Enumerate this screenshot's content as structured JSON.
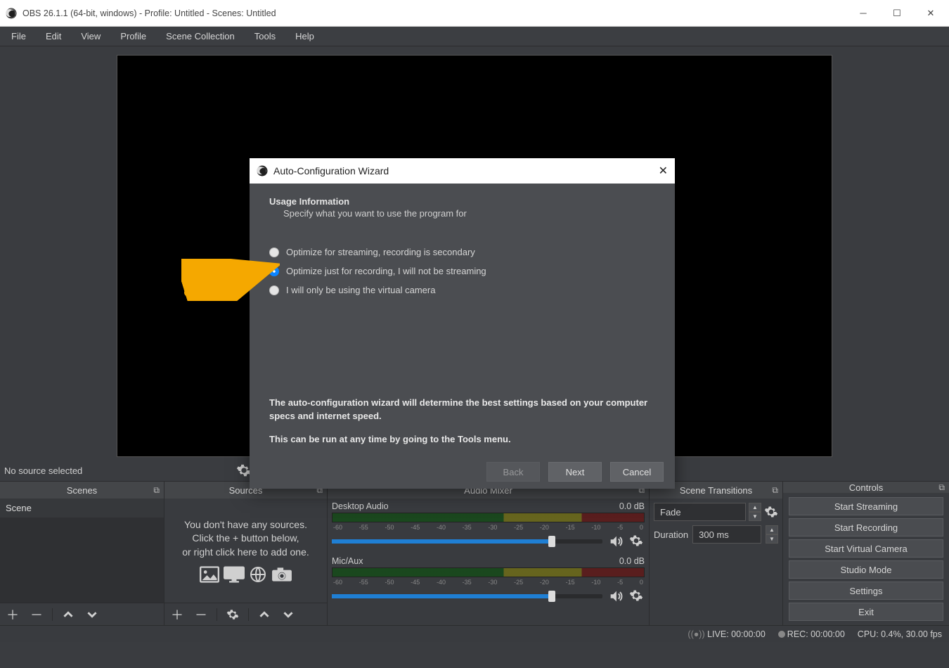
{
  "window": {
    "title": "OBS 26.1.1 (64-bit, windows) - Profile: Untitled - Scenes: Untitled"
  },
  "menus": [
    "File",
    "Edit",
    "View",
    "Profile",
    "Scene Collection",
    "Tools",
    "Help"
  ],
  "preview": {
    "no_source": "No source selected"
  },
  "docks": {
    "scenes": {
      "title": "Scenes",
      "item": "Scene"
    },
    "sources": {
      "title": "Sources",
      "empty1": "You don't have any sources.",
      "empty2": "Click the + button below,",
      "empty3": "or right click here to add one."
    },
    "mixer": {
      "title": "Audio Mixer",
      "channels": [
        {
          "name": "Desktop Audio",
          "level": "0.0 dB",
          "ticks": [
            "-60",
            "-55",
            "-50",
            "-45",
            "-40",
            "-35",
            "-30",
            "-25",
            "-20",
            "-15",
            "-10",
            "-5",
            "0"
          ]
        },
        {
          "name": "Mic/Aux",
          "level": "0.0 dB",
          "ticks": [
            "-60",
            "-55",
            "-50",
            "-45",
            "-40",
            "-35",
            "-30",
            "-25",
            "-20",
            "-15",
            "-10",
            "-5",
            "0"
          ]
        }
      ]
    },
    "transitions": {
      "title": "Scene Transitions",
      "fade": "Fade",
      "durationLabel": "Duration",
      "durationValue": "300 ms"
    },
    "controls": {
      "title": "Controls",
      "buttons": [
        "Start Streaming",
        "Start Recording",
        "Start Virtual Camera",
        "Studio Mode",
        "Settings",
        "Exit"
      ]
    }
  },
  "status": {
    "live": "LIVE: 00:00:00",
    "rec": "REC: 00:00:00",
    "cpu": "CPU: 0.4%, 30.00 fps"
  },
  "modal": {
    "title": "Auto-Configuration Wizard",
    "heading": "Usage Information",
    "sub": "Specify what you want to use the program for",
    "options": [
      "Optimize for streaming, recording is secondary",
      "Optimize just for recording, I will not be streaming",
      "I will only be using the virtual camera"
    ],
    "selected": 1,
    "desc1": "The auto-configuration wizard will determine the best settings based on your computer specs and internet speed.",
    "desc2": "This can be run at any time by going to the Tools menu.",
    "back": "Back",
    "next": "Next",
    "cancel": "Cancel"
  }
}
